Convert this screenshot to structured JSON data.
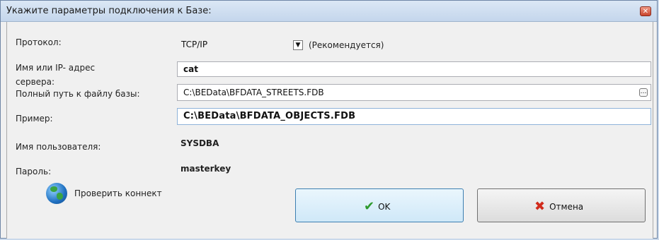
{
  "window": {
    "title": "Укажите параметры подключения к Базе:"
  },
  "form": {
    "protocol": {
      "label": "Протокол:",
      "value": "TCP/IP",
      "note": "(Рекомендуется)"
    },
    "server": {
      "label_line1": "Имя или IP- адрес",
      "label_line2": "сервера:",
      "value": "cat"
    },
    "db_path": {
      "label": "Полный путь к файлу базы:",
      "value": "C:\\BEData\\BFDATA_STREETS.FDB"
    },
    "example": {
      "label": "Пример:",
      "value": "C:\\BEData\\BFDATA_OBJECTS.FDB"
    },
    "user": {
      "label": "Имя пользователя:",
      "value": "SYSDBA"
    },
    "password": {
      "label": "Пароль:",
      "value": "masterkey"
    }
  },
  "actions": {
    "check_label": "Проверить коннект",
    "ok_label": "OK",
    "cancel_label": "Отмена"
  }
}
